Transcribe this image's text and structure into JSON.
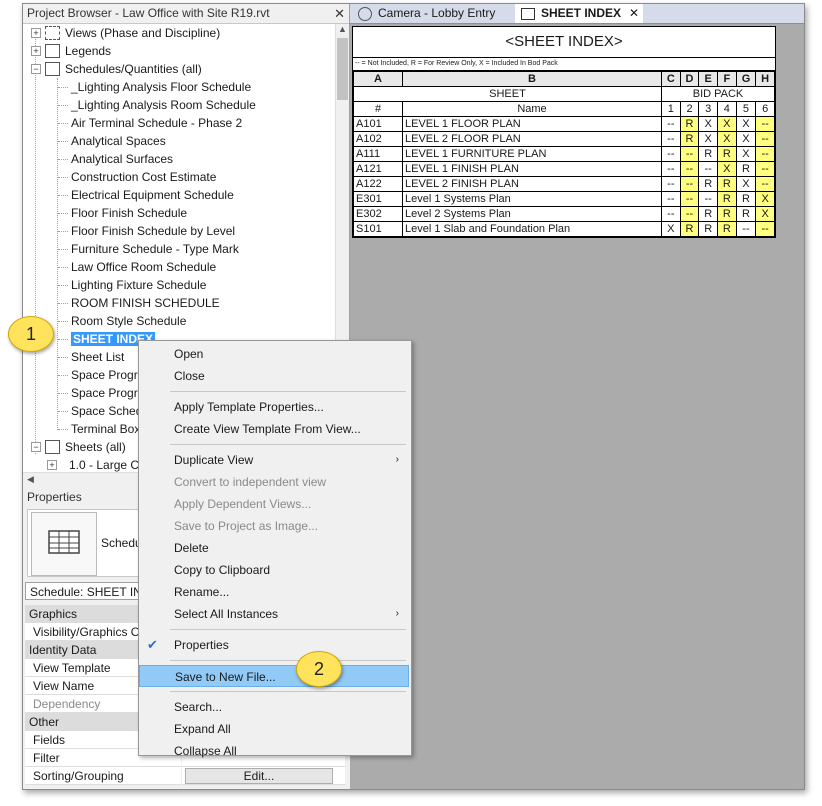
{
  "project_browser": {
    "title": "Project Browser - Law Office with Site R19.rvt",
    "close": "✕",
    "categories": [
      "Views (Phase and Discipline)",
      "Legends",
      "Schedules/Quantities (all)"
    ],
    "schedules": [
      "_Lighting Analysis Floor Schedule",
      "_Lighting Analysis Room Schedule",
      "Air Terminal Schedule - Phase 2",
      "Analytical Spaces",
      "Analytical Surfaces",
      "Construction Cost Estimate",
      "Electrical Equipment Schedule",
      "Floor Finish Schedule",
      "Floor Finish Schedule by Level",
      "Furniture Schedule - Type Mark",
      "Law Office Room Schedule",
      "Lighting Fixture Schedule",
      "ROOM FINISH SCHEDULE",
      "Room Style Schedule",
      "SHEET INDEX",
      "Sheet List",
      "Space Progra",
      "Space Progra",
      "Space Sched",
      "Terminal Box"
    ],
    "sheets_label": "Sheets (all)",
    "sheet_child": "1.0 - Large C"
  },
  "properties": {
    "title": "Properties",
    "type_label": "Schedu",
    "selector": "Schedule: SHEET INDE",
    "rows": [
      {
        "kind": "group",
        "label": "Graphics"
      },
      {
        "kind": "prop",
        "label": "Visibility/Graphics O"
      },
      {
        "kind": "group",
        "label": "Identity Data"
      },
      {
        "kind": "prop",
        "label": "View Template"
      },
      {
        "kind": "prop",
        "label": "View Name"
      },
      {
        "kind": "prop",
        "label": "Dependency",
        "dim": true
      },
      {
        "kind": "group",
        "label": "Other"
      },
      {
        "kind": "prop",
        "label": "Fields"
      },
      {
        "kind": "prop",
        "label": "Filter"
      },
      {
        "kind": "prop",
        "label": "Sorting/Grouping",
        "button": "Edit..."
      }
    ]
  },
  "tabs": [
    {
      "label": "Camera - Lobby Entry",
      "active": false
    },
    {
      "label": "SHEET INDEX",
      "active": true
    }
  ],
  "schedule": {
    "title": "<SHEET INDEX>",
    "legend": "-- = Not Included, R = For Review Only, X = Included In Bod Pack",
    "columns": [
      "A",
      "B",
      "C",
      "D",
      "E",
      "F",
      "G",
      "H"
    ],
    "group_sheet": "SHEET",
    "group_bid": "BID PACK",
    "hdr_num": "#",
    "hdr_name": "Name",
    "packs": [
      "1",
      "2",
      "3",
      "4",
      "5",
      "6"
    ],
    "rows": [
      {
        "num": "A101",
        "name": "LEVEL 1 FLOOR PLAN",
        "v": [
          "--",
          "R",
          "X",
          "X",
          "X",
          "--"
        ]
      },
      {
        "num": "A102",
        "name": "LEVEL 2 FLOOR PLAN",
        "v": [
          "--",
          "R",
          "X",
          "X",
          "X",
          "--"
        ]
      },
      {
        "num": "A111",
        "name": "LEVEL 1 FURNITURE PLAN",
        "v": [
          "--",
          "--",
          "R",
          "R",
          "X",
          "--"
        ]
      },
      {
        "num": "A121",
        "name": "LEVEL 1 FINISH PLAN",
        "v": [
          "--",
          "--",
          "--",
          "X",
          "R",
          "--"
        ]
      },
      {
        "num": "A122",
        "name": "LEVEL 2 FINISH PLAN",
        "v": [
          "--",
          "--",
          "R",
          "R",
          "X",
          "--"
        ]
      },
      {
        "num": "E301",
        "name": "Level 1 Systems Plan",
        "v": [
          "--",
          "--",
          "--",
          "R",
          "R",
          "X"
        ]
      },
      {
        "num": "E302",
        "name": "Level 2 Systems Plan",
        "v": [
          "--",
          "--",
          "R",
          "R",
          "R",
          "X"
        ]
      },
      {
        "num": "S101",
        "name": "Level 1 Slab and Foundation Plan",
        "v": [
          "X",
          "R",
          "R",
          "R",
          "--",
          "--"
        ]
      }
    ]
  },
  "context_menu": {
    "items": [
      {
        "label": "Open"
      },
      {
        "label": "Close"
      },
      {
        "sep": true
      },
      {
        "label": "Apply Template Properties..."
      },
      {
        "label": "Create View Template From View..."
      },
      {
        "sep": true
      },
      {
        "label": "Duplicate View",
        "submenu": true
      },
      {
        "label": "Convert to independent view",
        "disabled": true
      },
      {
        "label": "Apply Dependent Views...",
        "disabled": true
      },
      {
        "label": "Save to Project as Image...",
        "disabled": true
      },
      {
        "label": "Delete"
      },
      {
        "label": "Copy to Clipboard"
      },
      {
        "label": "Rename..."
      },
      {
        "label": "Select All Instances",
        "submenu": true
      },
      {
        "sep": true
      },
      {
        "label": "Properties",
        "checked": true
      },
      {
        "sep": true
      },
      {
        "label": "Save to New File...",
        "highlighted": true
      },
      {
        "sep": true
      },
      {
        "label": "Search..."
      },
      {
        "label": "Expand All"
      },
      {
        "label": "Collapse All"
      }
    ]
  },
  "callouts": [
    "1",
    "2"
  ],
  "colors": {
    "selection": "#3399ff",
    "menu_highlight": "#91c9f7",
    "bid_pack_fill": "#ffff80",
    "callout": "#ffe35c"
  }
}
